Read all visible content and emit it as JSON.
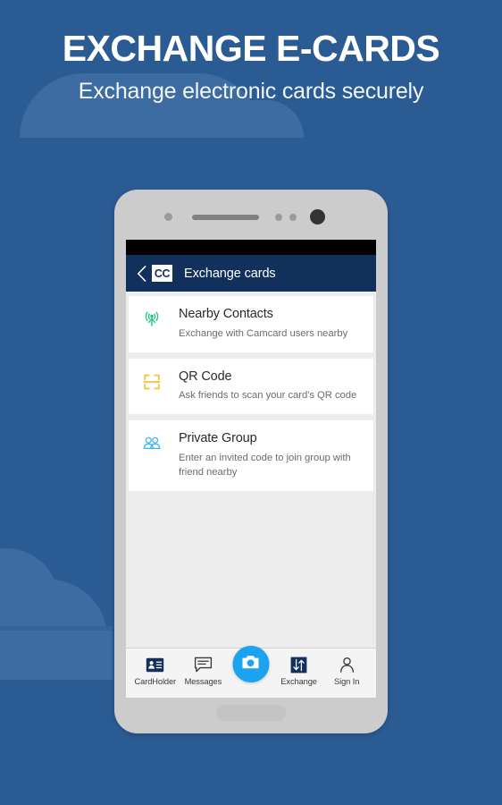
{
  "promo": {
    "headline": "EXCHANGE E-CARDS",
    "subheadline": "Exchange electronic cards securely",
    "background_color": "#2b5b93",
    "cloud_color": "#3c6ca2",
    "headline_color": "#ffffff"
  },
  "device": {
    "body_color": "#cccccc",
    "sensor_icon": "proximity-sensor-icon",
    "speaker_icon": "earpiece-speaker-icon",
    "front_camera_icon": "front-camera-icon",
    "home_button_icon": "home-button-icon"
  },
  "app": {
    "status_bar_color": "#000000",
    "app_bar": {
      "back_icon": "back-chevron-icon",
      "logo_text": "CC",
      "logo_name": "camcard-logo-icon",
      "title": "Exchange cards",
      "background_color": "#12305c"
    },
    "list_background": "#ededed",
    "items": [
      {
        "title": "Nearby Contacts",
        "subtitle": "Exchange with Camcard users nearby",
        "icon": "broadcast-antenna-icon",
        "icon_color": "#1fc47e"
      },
      {
        "title": "QR Code",
        "subtitle": "Ask friends to scan your card's QR code",
        "icon": "qr-scan-frame-icon",
        "icon_color": "#f5c32c"
      },
      {
        "title": "Private Group",
        "subtitle": "Enter an invited code to join group with friend nearby",
        "icon": "group-people-icon",
        "icon_color": "#3fb6ef"
      }
    ],
    "bottom_nav": {
      "items": [
        {
          "label": "CardHolder",
          "icon": "contact-card-icon",
          "active": false
        },
        {
          "label": "Messages",
          "icon": "speech-bubble-icon",
          "active": false
        },
        {
          "label": "Exchange",
          "icon": "exchange-arrows-icon",
          "active": true
        },
        {
          "label": "Sign In",
          "icon": "person-outline-icon",
          "active": false
        }
      ],
      "fab": {
        "icon": "camera-icon",
        "color": "#1ca3f0"
      }
    }
  }
}
